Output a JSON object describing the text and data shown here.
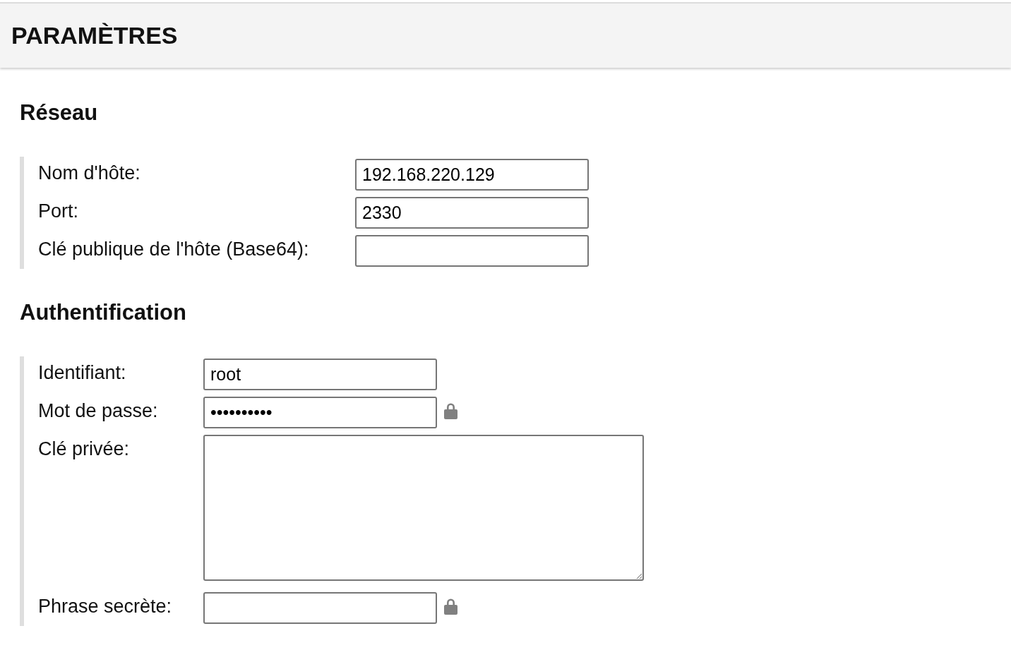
{
  "header": {
    "title": "PARAMÈTRES"
  },
  "sections": [
    {
      "title": "Réseau",
      "fields": [
        {
          "kind": "text",
          "label": "Nom d'hôte:",
          "value": "192.168.220.129"
        },
        {
          "kind": "text",
          "label": "Port:",
          "value": "2330"
        },
        {
          "kind": "text",
          "label": "Clé publique de l'hôte (Base64):"
        }
      ]
    },
    {
      "title": "Authentification",
      "fields": [
        {
          "kind": "text",
          "label": "Identifiant:",
          "value": "root"
        },
        {
          "kind": "password",
          "label": "Mot de passe:",
          "value": "••••••••••"
        },
        {
          "kind": "textarea",
          "label": "Clé privée:"
        },
        {
          "kind": "password",
          "label": "Phrase secrète:"
        }
      ]
    }
  ]
}
